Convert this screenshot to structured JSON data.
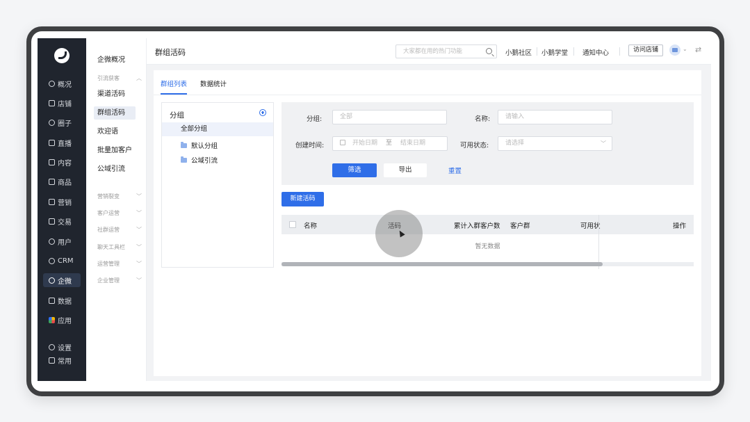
{
  "rail": {
    "items": [
      {
        "label": "概况",
        "icon": "pie-chart-icon"
      },
      {
        "label": "店铺",
        "icon": "store-icon"
      },
      {
        "label": "圈子",
        "icon": "community-icon"
      },
      {
        "label": "直播",
        "icon": "live-icon"
      },
      {
        "label": "内容",
        "icon": "document-icon"
      },
      {
        "label": "商品",
        "icon": "goods-icon"
      },
      {
        "label": "营销",
        "icon": "megaphone-icon"
      },
      {
        "label": "交易",
        "icon": "transaction-icon"
      },
      {
        "label": "用户",
        "icon": "user-icon"
      },
      {
        "label": "CRM",
        "icon": "crm-icon"
      },
      {
        "label": "企微",
        "icon": "wecom-icon"
      },
      {
        "label": "数据",
        "icon": "data-icon"
      },
      {
        "label": "应用",
        "icon": "apps-icon"
      },
      {
        "label": "设置",
        "icon": "settings-icon"
      },
      {
        "label": "常用",
        "icon": "list-icon"
      }
    ],
    "active": "企微"
  },
  "side": {
    "top": "企微概况",
    "section_open": "引流获客",
    "items": [
      "渠道活码",
      "群组活码",
      "欢迎语",
      "批量加客户",
      "公域引流"
    ],
    "active": "群组活码",
    "sections": [
      "营销裂变",
      "客户运营",
      "社群运营",
      "聊天工具栏",
      "运营管理",
      "企业管理"
    ]
  },
  "topbar": {
    "title": "群组活码",
    "search_placeholder": "大家都在用的热门功能",
    "links": [
      "小鹅社区",
      "小鹅学堂",
      "通知中心"
    ],
    "visit_store": "访问店铺"
  },
  "tabs": [
    "群组列表",
    "数据统计"
  ],
  "groups": {
    "title": "分组",
    "all": "全部分组",
    "items": [
      "默认分组",
      "公域引流"
    ]
  },
  "filter": {
    "group_label": "分组:",
    "group_value": "全部",
    "name_label": "名称:",
    "name_placeholder": "请输入",
    "time_label": "创建时间:",
    "start_placeholder": "开始日期",
    "range_sep": "至",
    "end_placeholder": "结束日期",
    "status_label": "可用状态:",
    "status_placeholder": "请选择",
    "btn_filter": "筛选",
    "btn_export": "导出",
    "btn_reset": "重置"
  },
  "new_button": "新建活码",
  "table": {
    "columns": [
      "名称",
      "活码",
      "累计入群客户数",
      "客户群",
      "可用状",
      "操作"
    ],
    "empty": "暂无数据"
  },
  "colors": {
    "accent": "#2f6ee8",
    "rail": "#20252e"
  }
}
